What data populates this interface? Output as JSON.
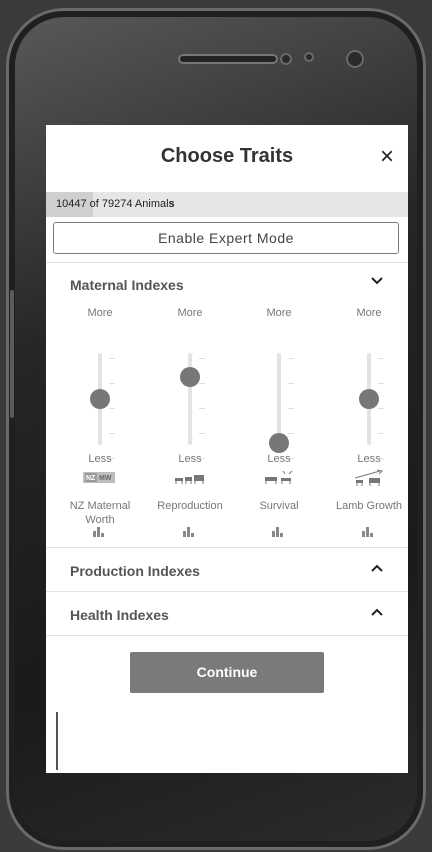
{
  "header": {
    "title": "Choose Traits",
    "close_label": "×"
  },
  "counter": {
    "count": "10447",
    "of_text": " of 79274 Animal",
    "suffix": "s",
    "fill_fraction": 0.13
  },
  "expert_button": {
    "label": "Enable Expert Mode"
  },
  "sections": {
    "maternal": {
      "label": "Maternal Indexes",
      "chevron": "⌄"
    },
    "production": {
      "label": "Production Indexes",
      "chevron": "^"
    },
    "health": {
      "label": "Health Indexes",
      "chevron": "^"
    }
  },
  "sliders": [
    {
      "more": "More",
      "less": "Less",
      "name": "NZ Maternal Worth",
      "level": 0.5,
      "icon": "nz-mw-logo-icon",
      "badge": "NZ",
      "badge2": "MW"
    },
    {
      "more": "More",
      "less": "Less",
      "name": "Reproduction",
      "level": 0.75,
      "icon": "sheep-family-icon"
    },
    {
      "more": "More",
      "less": "Less",
      "name": "Survival",
      "level": 0.0,
      "icon": "lamb-survival-icon"
    },
    {
      "more": "More",
      "less": "Less",
      "name": "Lamb Growth",
      "level": 0.5,
      "icon": "lamb-growth-icon"
    }
  ],
  "continue_button": {
    "label": "Continue"
  },
  "colors": {
    "thumb": "#777777",
    "button": "#7a7a7a"
  }
}
